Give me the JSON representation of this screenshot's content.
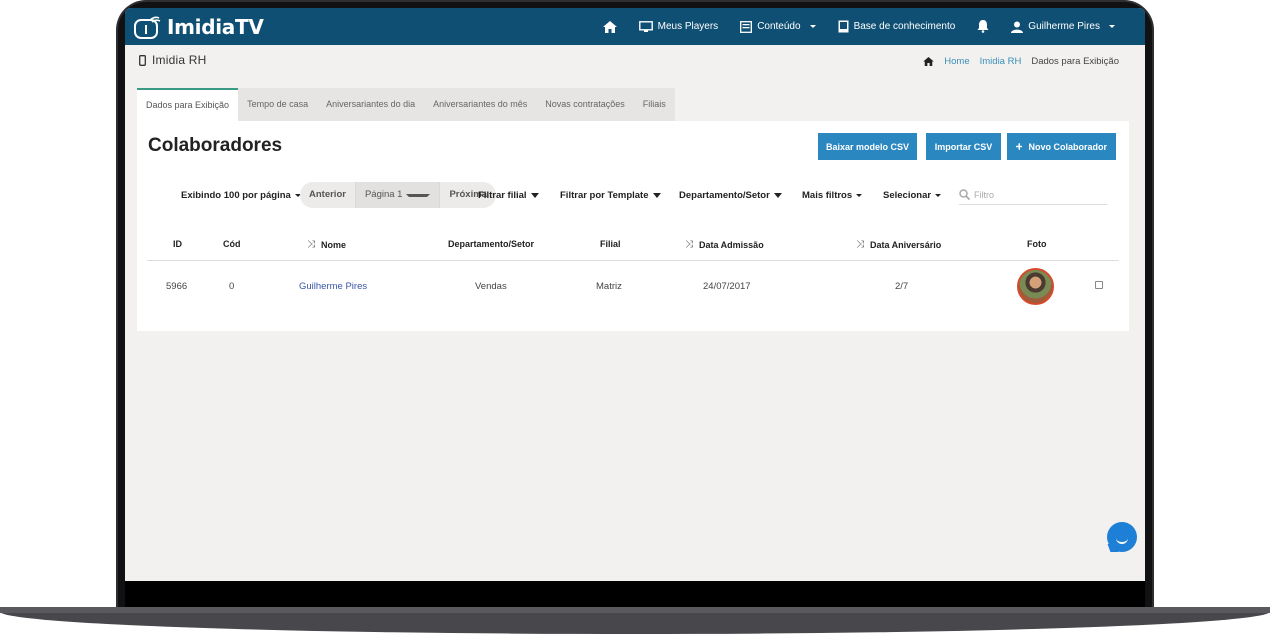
{
  "brand": {
    "logo_text": "ImidiaTV"
  },
  "navbar": {
    "home_label": "",
    "players_label": "Meus Players",
    "content_label": "Conteúdo",
    "knowledge_label": "Base de conhecimento",
    "user_label": "Guilherme Pires"
  },
  "subheader": {
    "page_label": "Imidia RH",
    "breadcrumb": {
      "home": "Home",
      "section": "Imidia RH",
      "current": "Dados para Exibição"
    }
  },
  "tabs": [
    {
      "label": "Dados para Exibição"
    },
    {
      "label": "Tempo de casa"
    },
    {
      "label": "Aniversariantes do dia"
    },
    {
      "label": "Aniversariantes do mês"
    },
    {
      "label": "Novas contratações"
    },
    {
      "label": "Filiais"
    }
  ],
  "panel": {
    "title": "Colaboradores",
    "buttons": {
      "download_csv": "Baixar modelo CSV",
      "import_csv": "Importar CSV",
      "new_employee": "Novo Colaborador"
    }
  },
  "toolbar": {
    "per_page": "Exibindo 100 por página",
    "prev": "Anterior",
    "page": "Página 1",
    "next": "Próxima",
    "filter_branch": "Filtrar filial",
    "filter_template": "Filtrar por Template",
    "department": "Departamento/Setor",
    "more_filters": "Mais filtros",
    "select": "Selecionar",
    "search_placeholder": "Filtro"
  },
  "table": {
    "headers": {
      "id": "ID",
      "cod": "Cód",
      "nome": "Nome",
      "departamento": "Departamento/Setor",
      "filial": "Filial",
      "admissao": "Data Admissão",
      "aniversario": "Data Aniversário",
      "foto": "Foto"
    },
    "rows": [
      {
        "id": "5966",
        "cod": "0",
        "nome": "Guilherme Pires",
        "departamento": "Vendas",
        "filial": "Matriz",
        "admissao": "24/07/2017",
        "aniversario": "2/7"
      }
    ]
  },
  "colors": {
    "navbar": "#0f4f73",
    "button": "#2b87c0",
    "active_tab_border": "#3a9a85",
    "link": "#3a8fb7"
  }
}
